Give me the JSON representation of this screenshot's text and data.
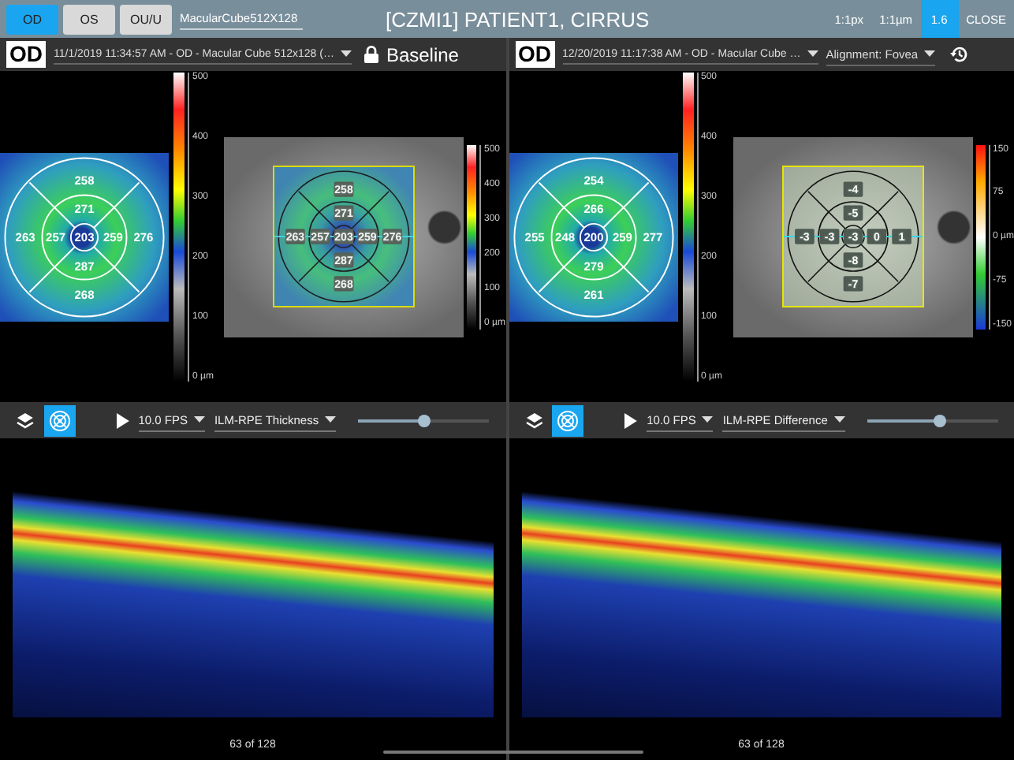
{
  "top_bar": {
    "eye_buttons": [
      {
        "label": "OD",
        "selected": true
      },
      {
        "label": "OS",
        "selected": false
      },
      {
        "label": "OU/U",
        "selected": false
      }
    ],
    "protocol": "MacularCube512X128",
    "title": "[CZMI1] PATIENT1, CIRRUS",
    "zoom_options": [
      {
        "label": "1:1px",
        "selected": false
      },
      {
        "label": "1:1µm",
        "selected": false
      },
      {
        "label": "1.6",
        "selected": true
      }
    ],
    "close": "CLOSE"
  },
  "panels": [
    {
      "eye": "OD",
      "exam": "11/1/2019 11:34:57 AM - OD - Macular Cube 512x128 (…",
      "header": {
        "kind": "baseline",
        "label": "Baseline"
      },
      "thickness_map": {
        "values": [
          "258",
          "271",
          "263",
          "257",
          "203",
          "259",
          "276",
          "287",
          "268"
        ],
        "scale": [
          "500",
          "400",
          "300",
          "200",
          "100",
          "0 µm"
        ]
      },
      "overlay": {
        "kind": "thickness",
        "values": [
          "258",
          "271",
          "263",
          "257",
          "203",
          "259",
          "276",
          "287",
          "268"
        ],
        "scale": [
          "500",
          "400",
          "300",
          "200",
          "100",
          "0 µm"
        ]
      },
      "controls": {
        "overlay_on": true,
        "fps": "10.0 FPS",
        "metric": "ILM-RPE Thickness",
        "level": 0.5
      },
      "scan": {
        "caption": "63 of 128"
      }
    },
    {
      "eye": "OD",
      "exam": "12/20/2019 11:17:38 AM - OD - Macular Cube …",
      "header": {
        "kind": "alignment",
        "label": "Alignment: Fovea"
      },
      "thickness_map": {
        "values": [
          "254",
          "266",
          "255",
          "248",
          "200",
          "259",
          "277",
          "279",
          "261"
        ],
        "scale": [
          "500",
          "400",
          "300",
          "200",
          "100",
          "0 µm"
        ]
      },
      "overlay": {
        "kind": "difference",
        "values": [
          "-4",
          "-5",
          "-3",
          "-3",
          "-3",
          "0",
          "1",
          "-8",
          "-7"
        ],
        "scale": [
          "150",
          "75",
          "0 µm",
          "-75",
          "-150"
        ]
      },
      "controls": {
        "overlay_on": true,
        "fps": "10.0 FPS",
        "metric": "ILM-RPE Difference",
        "level": 0.55
      },
      "scan": {
        "caption": "63 of 128"
      }
    }
  ]
}
